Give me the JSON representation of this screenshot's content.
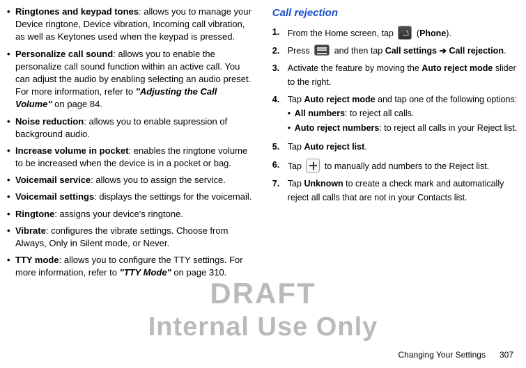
{
  "leftColumn": {
    "items": [
      {
        "term": "Ringtones and keypad tones",
        "desc": ": allows you to manage your Device ringtone, Device vibration, Incoming call vibration, as well as Keytones used when the keypad is pressed."
      },
      {
        "term": "Personalize call sound",
        "desc_pre": ": allows you to enable the personalize call sound function within an active call. You can adjust the audio by enabling selecting an audio preset. For more information, refer to ",
        "ref": "\"Adjusting the Call Volume\"",
        "desc_post": "  on page 84."
      },
      {
        "term": "Noise reduction",
        "desc": ": allows you to enable supression of background audio."
      },
      {
        "term": "Increase volume in pocket",
        "desc": ": enables the ringtone volume to be increased when the device is in a pocket or bag."
      },
      {
        "term": "Voicemail service",
        "desc": ": allows you to assign the service."
      },
      {
        "term": "Voicemail settings",
        "desc": ": displays the settings for the voicemail."
      },
      {
        "term": "Ringtone",
        "desc": ": assigns your device's ringtone."
      },
      {
        "term": "Vibrate",
        "desc": ": configures the vibrate settings. Choose from Always, Only in Silent mode, or Never."
      },
      {
        "term": "TTY mode",
        "desc_pre": ": allows you to configure the TTY settings. For more information, refer to ",
        "ref": "\"TTY Mode\"",
        "desc_post": "  on page 310."
      }
    ]
  },
  "rightColumn": {
    "heading": "Call rejection",
    "steps": {
      "1": {
        "pre": "From the Home screen, tap ",
        "post_open": " (",
        "b1": "Phone",
        "post_close": ")."
      },
      "2": {
        "pre": "Press ",
        "mid": " and then tap ",
        "b1": "Call settings",
        "arrow": " ➔ ",
        "b2": "Call rejection",
        "end": "."
      },
      "3": {
        "pre": "Activate the feature by moving the ",
        "b1": "Auto reject mode",
        "post": " slider to the right."
      },
      "4": {
        "pre": "Tap ",
        "b1": "Auto reject mode",
        "post": " and tap one of the following options:",
        "sub": [
          {
            "term": "All numbers",
            "desc": ": to reject all calls."
          },
          {
            "term": "Auto reject numbers",
            "desc": ": to reject all calls in your Reject list."
          }
        ]
      },
      "5": {
        "pre": "Tap ",
        "b1": "Auto reject list",
        "end": "."
      },
      "6": {
        "pre": "Tap ",
        "post": "  to manually add numbers to the Reject list."
      },
      "7": {
        "pre": "Tap ",
        "b1": "Unknown",
        "post": " to create a check mark and automatically reject all calls that are not in your Contacts list."
      }
    }
  },
  "footer": {
    "section": "Changing Your Settings",
    "page": "307"
  },
  "watermark": {
    "line1": "DRAFT",
    "line2": "Internal Use Only"
  }
}
